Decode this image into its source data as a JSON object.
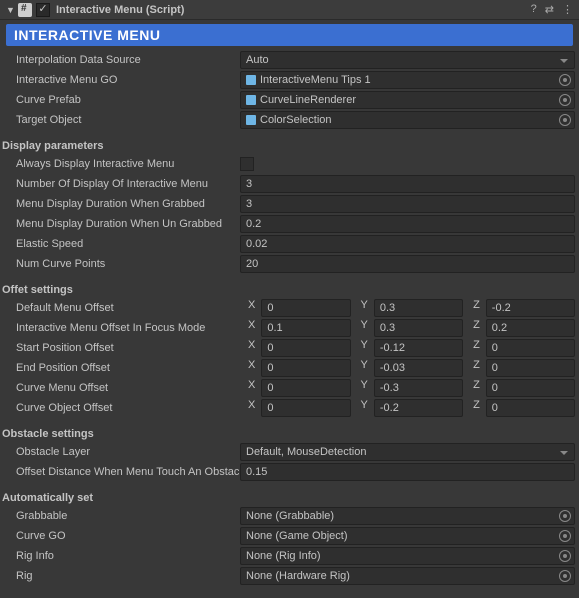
{
  "header": {
    "title": "Interactive Menu (Script)",
    "enabled": true,
    "banner": "INTERACTIVE MENU"
  },
  "props": {
    "interpolation_label": "Interpolation Data Source",
    "interpolation_value": "Auto",
    "interactive_go_label": "Interactive Menu GO",
    "interactive_go_value": "InteractiveMenu Tips 1",
    "curve_prefab_label": "Curve Prefab",
    "curve_prefab_value": "CurveLineRenderer",
    "target_label": "Target Object",
    "target_value": "ColorSelection"
  },
  "display": {
    "section": "Display parameters",
    "always_label": "Always Display Interactive Menu",
    "numdisp_label": "Number Of Display Of Interactive Menu",
    "numdisp_value": "3",
    "grabbed_label": "Menu Display Duration When Grabbed",
    "grabbed_value": "3",
    "ungrabbed_label": "Menu Display Duration When Un Grabbed",
    "ungrabbed_value": "0.2",
    "elastic_label": "Elastic Speed",
    "elastic_value": "0.02",
    "ncurve_label": "Num Curve Points",
    "ncurve_value": "20"
  },
  "offset": {
    "section": "Offet settings",
    "default_label": "Default Menu Offset",
    "default": {
      "x": "0",
      "y": "0.3",
      "z": "-0.2"
    },
    "focus_label": "Interactive Menu Offset In Focus Mode",
    "focus": {
      "x": "0.1",
      "y": "0.3",
      "z": "0.2"
    },
    "start_label": "Start Position Offset",
    "start": {
      "x": "0",
      "y": "-0.12",
      "z": "0"
    },
    "end_label": "End Position Offset",
    "end": {
      "x": "0",
      "y": "-0.03",
      "z": "0"
    },
    "curvemenu_label": "Curve Menu Offset",
    "curvemenu": {
      "x": "0",
      "y": "-0.3",
      "z": "0"
    },
    "curveobj_label": "Curve Object Offset",
    "curveobj": {
      "x": "0",
      "y": "-0.2",
      "z": "0"
    }
  },
  "obstacle": {
    "section": "Obstacle settings",
    "layer_label": "Obstacle Layer",
    "layer_value": "Default, MouseDetection",
    "offsetdist_label": "Offset Distance When Menu Touch An Obstacle",
    "offsetdist_value": "0.15"
  },
  "auto": {
    "section": "Automatically set",
    "grabbable_label": "Grabbable",
    "grabbable_value": "None (Grabbable)",
    "curvego_label": "Curve GO",
    "curvego_value": "None (Game Object)",
    "riginfo_label": "Rig Info",
    "riginfo_value": "None (Rig Info)",
    "rig_label": "Rig",
    "rig_value": "None (Hardware Rig)"
  },
  "labels": {
    "x": "X",
    "y": "Y",
    "z": "Z"
  }
}
